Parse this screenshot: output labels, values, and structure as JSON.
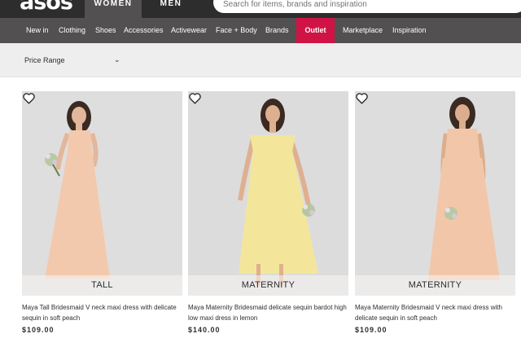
{
  "header": {
    "logo": "asos",
    "tabs": [
      "WOMEN",
      "MEN"
    ],
    "search": {
      "placeholder": "Search for items, brands and inspiration"
    }
  },
  "nav": {
    "items": [
      "New in",
      "Clothing",
      "Shoes",
      "Accessories",
      "Activewear",
      "Face + Body",
      "Brands",
      "Outlet",
      "Marketplace",
      "Inspiration"
    ],
    "highlight": "Outlet",
    "highlight_color": "#d01345"
  },
  "filters": {
    "price_range": "Price Range",
    "chevron_icon": "chevron-down-icon"
  },
  "products": [
    {
      "badge": "TALL",
      "title": "Maya Tall Bridesmaid V neck maxi dress with delicate sequin in soft peach",
      "price": "$109.00",
      "dress_color": "#f3c9ae"
    },
    {
      "badge": "MATERNITY",
      "title": "Maya Maternity Bridesmaid delicate sequin bardot high low maxi dress in lemon",
      "price": "$140.00",
      "dress_color": "#f3e69b"
    },
    {
      "badge": "MATERNITY",
      "title": "Maya Maternity Bridesmaid V neck maxi dress with delicate sequin in soft peach",
      "price": "$109.00",
      "dress_color": "#f2c7a9"
    }
  ],
  "colors": {
    "topbar": "#2d2d2d",
    "navbar": "#525050",
    "filterbar": "#eeeeee"
  }
}
